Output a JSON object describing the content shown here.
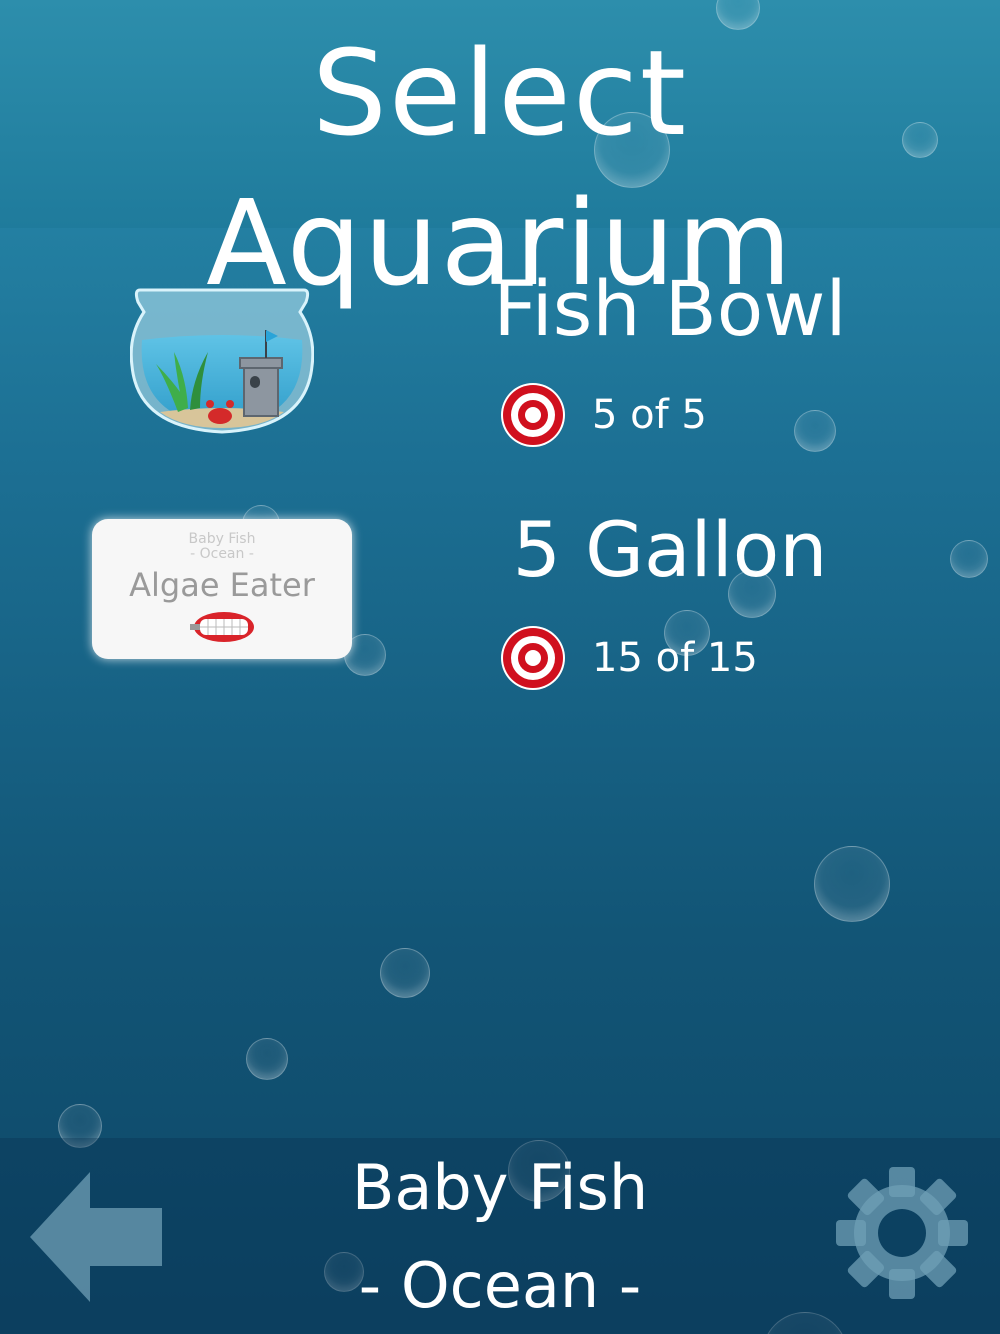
{
  "header": {
    "title": "Select Aquarium"
  },
  "aquariums": [
    {
      "name": "Fish Bowl",
      "progress": "5 of 5",
      "thumbnail_icon": "fish-bowl-icon"
    },
    {
      "name": "5 Gallon",
      "progress": "15 of 15",
      "thumbnail_icon": "algae-eater-card",
      "card": {
        "small_title": "Baby Fish",
        "small_subtitle": "- Ocean -",
        "label": "Algae Eater"
      }
    }
  ],
  "footer": {
    "line1": "Baby Fish",
    "line2": "- Ocean -"
  },
  "icons": {
    "back": "back-arrow-icon",
    "settings": "gear-icon",
    "score": "target-icon"
  },
  "colors": {
    "background_top": "#2a8fb0",
    "background_bottom": "#0e4767",
    "target_red": "#d0101e"
  }
}
